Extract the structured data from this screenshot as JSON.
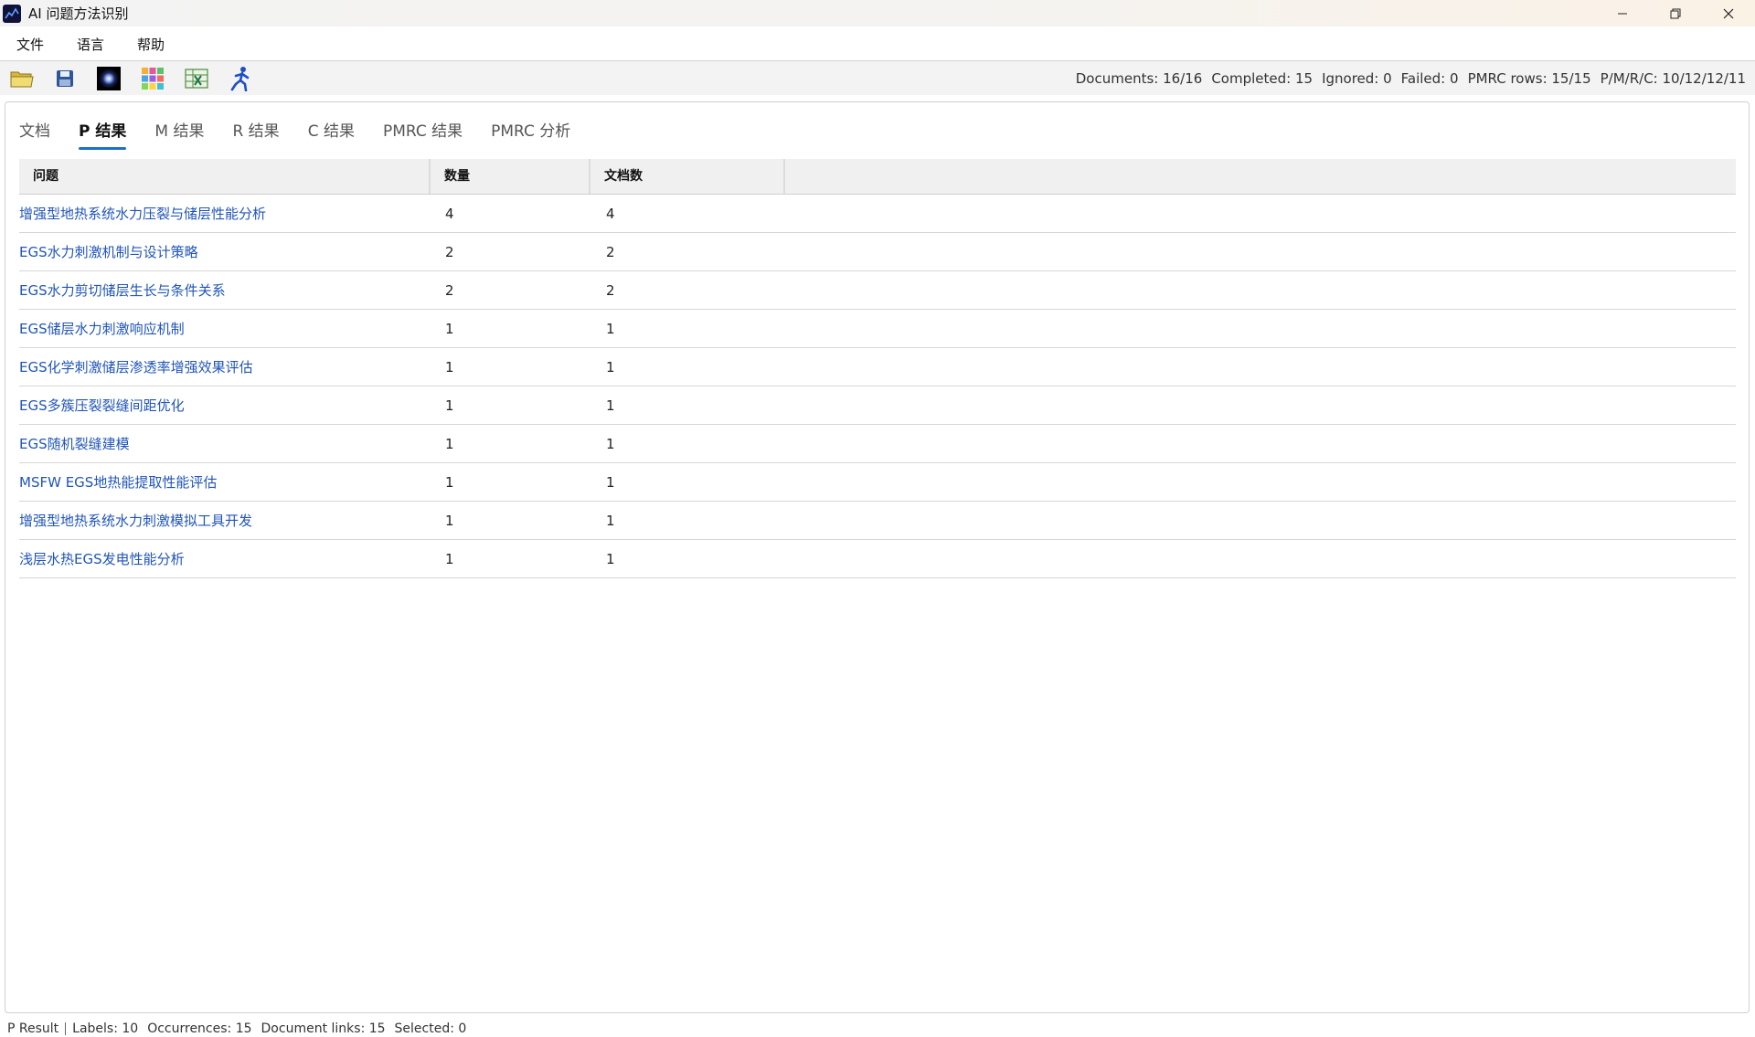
{
  "window": {
    "title": "AI 问题方法识别",
    "controls": {
      "minimize": "—",
      "restore": "❐",
      "close": "✕"
    }
  },
  "menu": [
    "文件",
    "语言",
    "帮助"
  ],
  "toolbar": {
    "icons": [
      "open-folder-icon",
      "save-icon",
      "blackhole-icon",
      "color-grid-icon",
      "excel-export-icon",
      "run-person-icon"
    ]
  },
  "status": {
    "documents": "Documents: 16/16",
    "completed": "Completed: 15",
    "ignored": "Ignored: 0",
    "failed": "Failed: 0",
    "pmrc_rows": "PMRC rows: 15/15",
    "pmrc_counts": "P/M/R/C: 10/12/12/11"
  },
  "tabs": [
    {
      "label": "文档",
      "active": false
    },
    {
      "label": "P 结果",
      "active": true
    },
    {
      "label": "M 结果",
      "active": false
    },
    {
      "label": "R 结果",
      "active": false
    },
    {
      "label": "C 结果",
      "active": false
    },
    {
      "label": "PMRC 结果",
      "active": false
    },
    {
      "label": "PMRC 分析",
      "active": false
    }
  ],
  "table": {
    "headers": [
      "问题",
      "数量",
      "文档数"
    ],
    "rows": [
      {
        "problem": "增强型地热系统水力压裂与储层性能分析",
        "count": "4",
        "docs": "4"
      },
      {
        "problem": "EGS水力刺激机制与设计策略",
        "count": "2",
        "docs": "2"
      },
      {
        "problem": "EGS水力剪切储层生长与条件关系",
        "count": "2",
        "docs": "2"
      },
      {
        "problem": "EGS储层水力刺激响应机制",
        "count": "1",
        "docs": "1"
      },
      {
        "problem": "EGS化学刺激储层渗透率增强效果评估",
        "count": "1",
        "docs": "1"
      },
      {
        "problem": "EGS多簇压裂裂缝间距优化",
        "count": "1",
        "docs": "1"
      },
      {
        "problem": "EGS随机裂缝建模",
        "count": "1",
        "docs": "1"
      },
      {
        "problem": "MSFW EGS地热能提取性能评估",
        "count": "1",
        "docs": "1"
      },
      {
        "problem": "增强型地热系统水力刺激模拟工具开发",
        "count": "1",
        "docs": "1"
      },
      {
        "problem": "浅层水热EGS发电性能分析",
        "count": "1",
        "docs": "1"
      }
    ]
  },
  "footer": {
    "view": "P Result",
    "labels": "Labels: 10",
    "occurrences": "Occurrences: 15",
    "document_links": "Document links: 15",
    "selected": "Selected: 0"
  },
  "colors": {
    "accent": "#1a6fd0",
    "link": "#2055b8",
    "header_bg": "#f0f0f0"
  }
}
